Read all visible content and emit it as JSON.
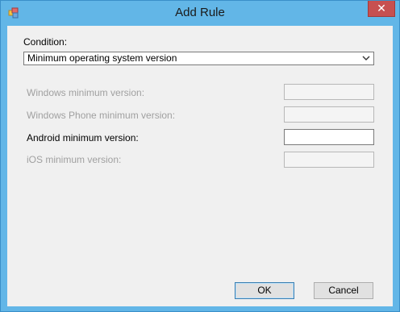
{
  "window": {
    "title": "Add Rule",
    "close_label": "✕"
  },
  "condition": {
    "label": "Condition:",
    "selected": "Minimum operating system version"
  },
  "fields": [
    {
      "label": "Windows minimum version:",
      "value": "",
      "enabled": false
    },
    {
      "label": "Windows Phone minimum version:",
      "value": "",
      "enabled": false
    },
    {
      "label": "Android minimum version:",
      "value": "",
      "enabled": true
    },
    {
      "label": "iOS minimum version:",
      "value": "",
      "enabled": false
    }
  ],
  "buttons": {
    "ok": "OK",
    "cancel": "Cancel"
  },
  "colors": {
    "title_bar": "#62b6e7",
    "close": "#c75050",
    "client": "#f0f0f0"
  },
  "icons": {
    "app": "app-window-icon",
    "dropdown": "chevron-down-icon"
  }
}
